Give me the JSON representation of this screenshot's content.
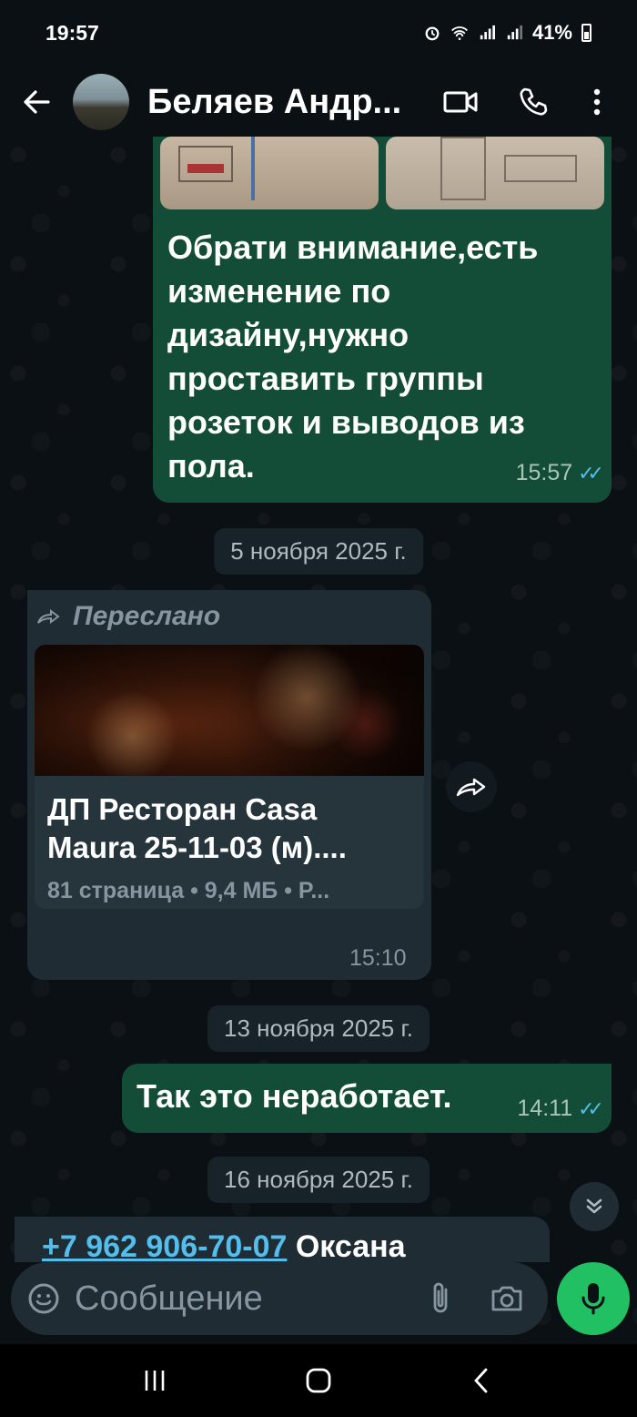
{
  "status_bar": {
    "time": "19:57",
    "battery": "41%"
  },
  "header": {
    "contact_name": "Беляев Андр..."
  },
  "messages": {
    "m1": {
      "text": "Обрати внимание,есть изменение по дизайну,нужно проставить группы розеток и выводов из пола.",
      "time": "15:57"
    },
    "date1": "5 ноября 2025 г.",
    "m2": {
      "forwarded_label": "Переслано",
      "doc_title": "ДП Ресторан Casa Maura 25-11-03 (м)....",
      "doc_meta": "81 страница • 9,4 МБ • P...",
      "time": "15:10"
    },
    "date2": "13 ноября 2025 г.",
    "m3": {
      "text": "Так это неработает.",
      "time": "14:11"
    },
    "date3": "16 ноября 2025 г.",
    "m4": {
      "phone": "+7 962 906-70-07",
      "name": "Оксана"
    }
  },
  "composer": {
    "placeholder": "Сообщение"
  },
  "icons": {
    "back": "arrow-left-icon",
    "video": "video-call-icon",
    "call": "phone-icon",
    "menu": "more-vertical-icon",
    "emoji": "emoji-icon",
    "attach": "paperclip-icon",
    "camera": "camera-icon",
    "mic": "microphone-icon"
  },
  "colors": {
    "outgoing_bubble": "#134d37",
    "incoming_bubble": "#1f2c34",
    "accent": "#21c063",
    "read_ticks": "#53bdeb"
  }
}
